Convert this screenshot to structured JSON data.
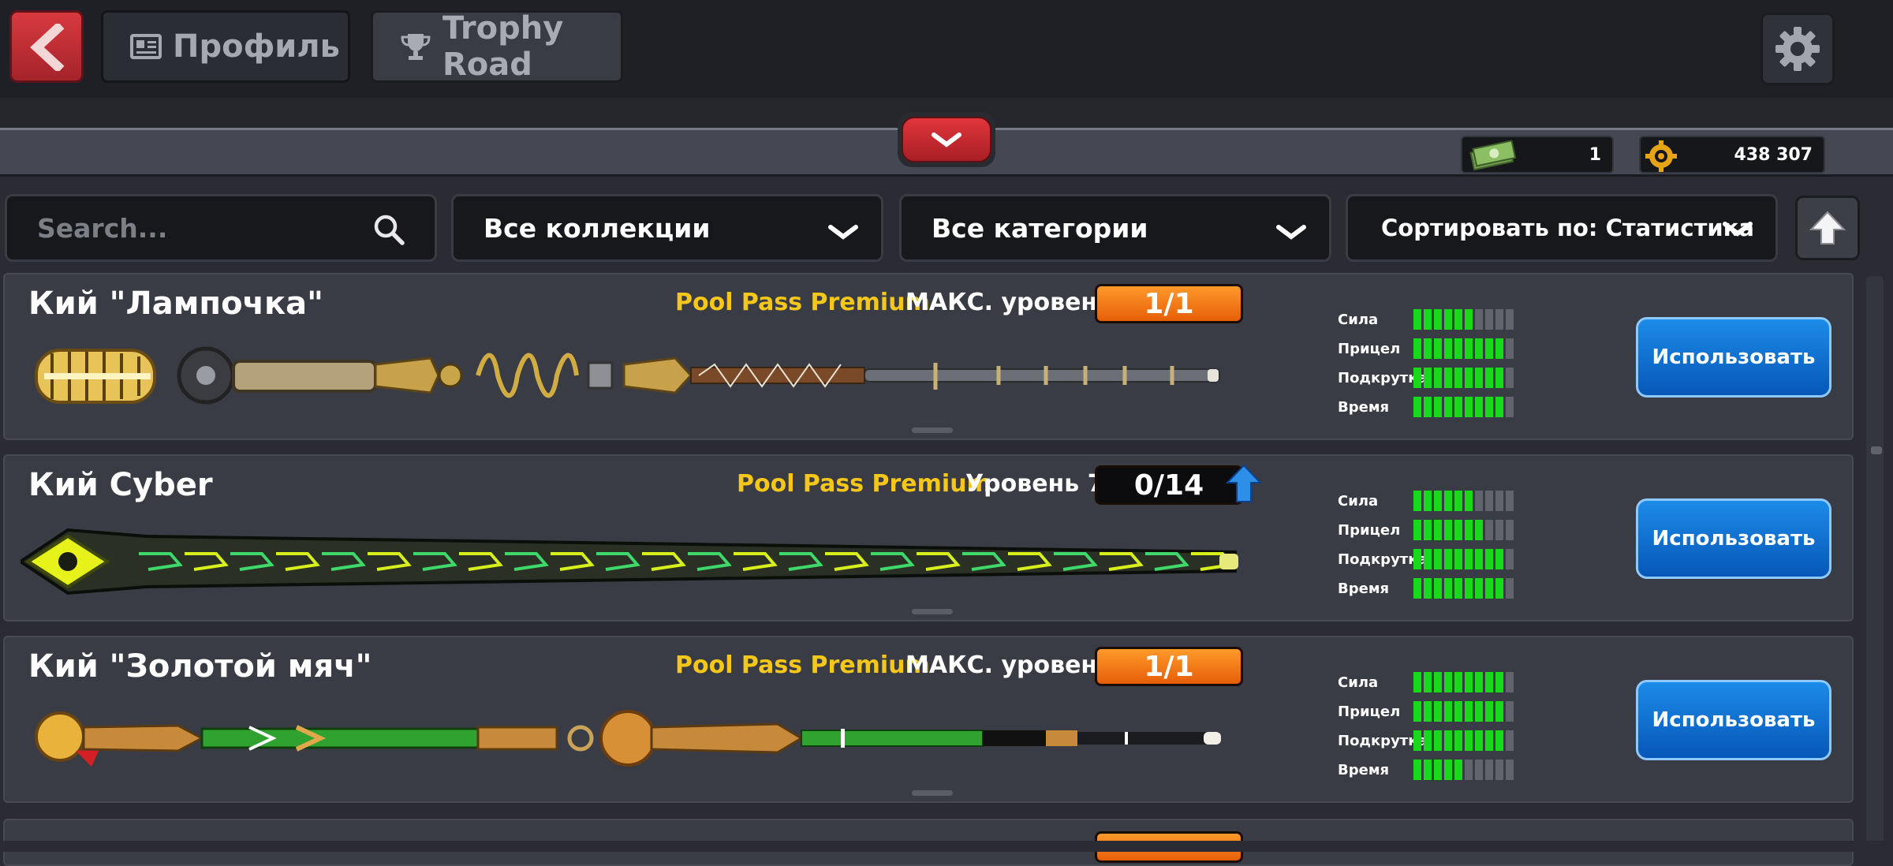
{
  "header": {
    "back_icon": "chevron-left-icon",
    "tabs": [
      {
        "label": "Профиль",
        "icon": "profile-card-icon"
      },
      {
        "label": "Trophy Road",
        "icon": "trophy-icon"
      }
    ],
    "settings_icon": "gear-icon"
  },
  "currency": {
    "cash": {
      "value": "1",
      "icon": "cash-icon"
    },
    "coins": {
      "value": "438 307",
      "icon": "coin-icon"
    }
  },
  "filters": {
    "search_placeholder": "Search...",
    "collection": "Все коллекции",
    "category": "Все категории",
    "sort": "Сортировать по: Статистика"
  },
  "stat_labels": [
    "Сила",
    "Прицел",
    "Подкрутка",
    "Время"
  ],
  "cues": [
    {
      "name": "Кий \"Лампочка\"",
      "pass": "Pool Pass Premium",
      "level_text": "МАКС. уровень",
      "progress": "1/1",
      "max": true,
      "stats": [
        6,
        9,
        9,
        9
      ],
      "button": "Использовать",
      "style": "lamp"
    },
    {
      "name": "Кий Cyber",
      "pass": "Pool Pass Premium",
      "level_text": "Уровень 7",
      "progress": "0/14",
      "max": false,
      "stats": [
        6,
        7,
        9,
        9
      ],
      "button": "Использовать",
      "style": "cyber"
    },
    {
      "name": "Кий \"Золотой мяч\"",
      "pass": "Pool Pass Premium",
      "level_text": "МАКС. уровень",
      "progress": "1/1",
      "max": true,
      "stats": [
        9,
        9,
        9,
        5
      ],
      "button": "Использовать",
      "style": "gold"
    }
  ],
  "stat_max": 10,
  "colors": {
    "pass": "#f4c719",
    "bar_on": "#19d91b",
    "accent_red": "#d8393f",
    "button_blue": "#0a6ad0"
  }
}
